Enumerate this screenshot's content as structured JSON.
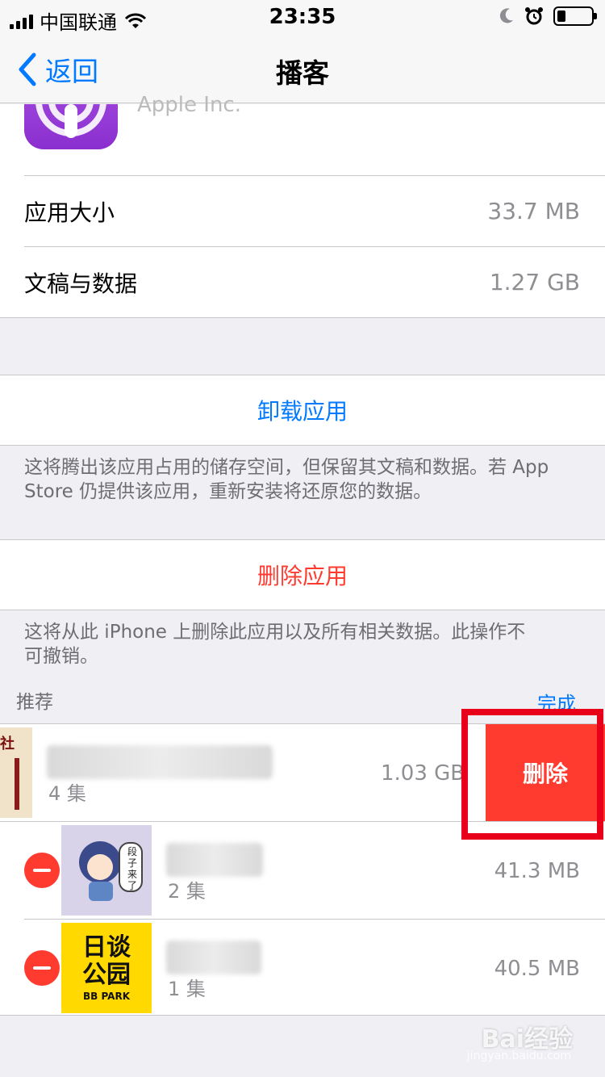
{
  "status_bar": {
    "carrier": "中国联通",
    "time": "23:35",
    "battery_level": 0.25
  },
  "nav": {
    "back_label": "返回",
    "title": "播客"
  },
  "app": {
    "maker": "Apple Inc.",
    "rows": [
      {
        "label": "应用大小",
        "value": "33.7 MB"
      },
      {
        "label": "文稿与数据",
        "value": "1.27 GB"
      }
    ]
  },
  "offload": {
    "label": "卸载应用",
    "note": "这将腾出该应用占用的储存空间，但保留其文稿和数据。若 App Store 仍提供该应用，重新安装将还原您的数据。"
  },
  "delete_app": {
    "label": "删除应用",
    "note": "这将从此 iPhone 上删除此应用以及所有相关数据。此操作不可撤销。"
  },
  "recommended": {
    "header": "推荐",
    "done_label": "完成",
    "items": [
      {
        "episodes": "4 集",
        "size": "1.03 GB"
      },
      {
        "episodes": "2 集",
        "size": "41.3 MB"
      },
      {
        "episodes": "1 集",
        "size": "40.5 MB"
      }
    ],
    "delete_label": "删除",
    "thumb2_caption": "段子来了",
    "thumb3_line1": "日谈",
    "thumb3_line2": "公园",
    "thumb3_sub": "BB PARK",
    "thumb1_text": "社"
  },
  "watermark": {
    "brand": "Bai经验",
    "url": "jingyan.baidu.com"
  },
  "colors": {
    "accent": "#007aff",
    "destructive": "#ff3b30",
    "highlight": "#e8001a"
  }
}
